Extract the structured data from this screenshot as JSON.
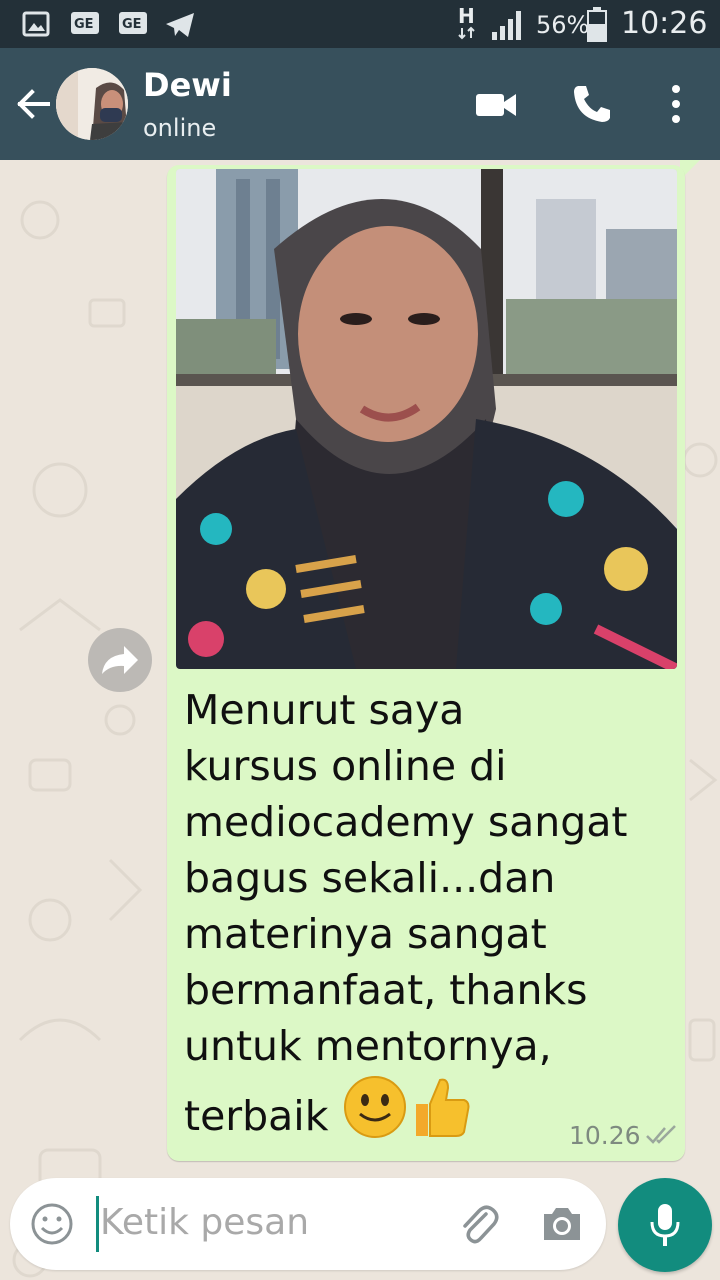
{
  "status_bar": {
    "battery": "56%",
    "time": "10:26",
    "network": "H"
  },
  "header": {
    "contact_name": "Dewi",
    "contact_status": "online",
    "icons": [
      "back-arrow-icon",
      "video-call-icon",
      "phone-icon",
      "more-options-icon"
    ]
  },
  "message": {
    "lines": "Menurut saya\nkursus online di\nmediocademy sangat\nbagus sekali...dan\nmaterinya sangat\nbermanfaat, thanks\nuntuk mentornya,",
    "last_line": "terbaik",
    "emojis": [
      "slightly-smiling-face",
      "thumbs-up"
    ],
    "time": "10.26",
    "status": "delivered"
  },
  "composer": {
    "placeholder": "Ketik pesan"
  },
  "colors": {
    "status_bar": "#233038",
    "app_bar": "#37505c",
    "bubble": "#dcf8c6",
    "accent": "#128c7e"
  }
}
